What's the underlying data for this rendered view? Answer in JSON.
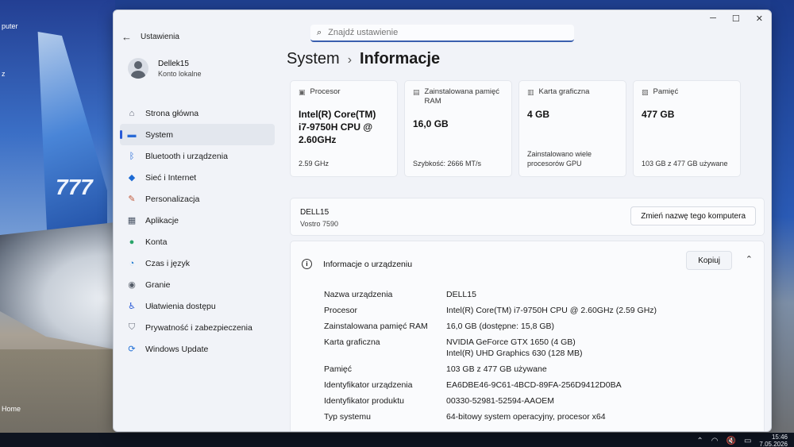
{
  "desktop": {
    "icon_label_top": "puter",
    "icon_label_mid": "z",
    "icon_label_bottom": "Home",
    "plane_text": "777"
  },
  "taskbar": {
    "time": "15:46",
    "date": "7.05.2026"
  },
  "window": {
    "app_title": "Ustawienia",
    "search_placeholder": "Znajdź ustawienie"
  },
  "sidebar": {
    "user_name": "Dellek15",
    "user_type": "Konto lokalne",
    "items": [
      {
        "label": "Strona główna",
        "icon": "home-icon"
      },
      {
        "label": "System",
        "icon": "monitor-icon",
        "active": true
      },
      {
        "label": "Bluetooth i urządzenia",
        "icon": "bluetooth-icon"
      },
      {
        "label": "Sieć i Internet",
        "icon": "wifi-icon"
      },
      {
        "label": "Personalizacja",
        "icon": "brush-icon"
      },
      {
        "label": "Aplikacje",
        "icon": "apps-icon"
      },
      {
        "label": "Konta",
        "icon": "person-icon"
      },
      {
        "label": "Czas i język",
        "icon": "globe-clock-icon"
      },
      {
        "label": "Granie",
        "icon": "gamepad-icon"
      },
      {
        "label": "Ułatwienia dostępu",
        "icon": "accessibility-icon"
      },
      {
        "label": "Prywatność i zabezpieczenia",
        "icon": "shield-icon"
      },
      {
        "label": "Windows Update",
        "icon": "update-icon"
      }
    ]
  },
  "main": {
    "breadcrumb_parent": "System",
    "breadcrumb_sep": "›",
    "breadcrumb_current": "Informacje",
    "cards": [
      {
        "label": "Procesor",
        "value": "Intel(R) Core(TM) i7-9750H CPU @ 2.60GHz",
        "sub": "2.59 GHz",
        "icon": "cpu-icon"
      },
      {
        "label": "Zainstalowana pamięć RAM",
        "value": "16,0 GB",
        "sub": "Szybkość: 2666 MT/s",
        "icon": "ram-icon"
      },
      {
        "label": "Karta graficzna",
        "value": "4 GB",
        "sub": "Zainstalowano wiele procesorów GPU",
        "icon": "gpu-icon"
      },
      {
        "label": "Pamięć",
        "value": "477 GB",
        "sub": "103 GB z 477 GB używane",
        "icon": "storage-icon"
      }
    ],
    "computer": {
      "name": "DELL15",
      "model": "Vostro 7590",
      "rename_label": "Zmień nazwę tego komputera"
    },
    "device_info": {
      "title": "Informacje o urządzeniu",
      "copy_label": "Kopiuj",
      "rows": [
        {
          "key": "Nazwa urządzenia",
          "values": [
            "DELL15"
          ]
        },
        {
          "key": "Procesor",
          "values": [
            "Intel(R) Core(TM) i7-9750H CPU @ 2.60GHz (2.59 GHz)"
          ]
        },
        {
          "key": "Zainstalowana pamięć RAM",
          "values": [
            "16,0 GB (dostępne: 15,8 GB)"
          ]
        },
        {
          "key": "Karta graficzna",
          "values": [
            "NVIDIA GeForce GTX 1650 (4 GB)",
            "Intel(R) UHD Graphics 630 (128 MB)"
          ]
        },
        {
          "key": "Pamięć",
          "values": [
            "103 GB z 477 GB używane"
          ]
        },
        {
          "key": "Identyfikator urządzenia",
          "values": [
            "EA6DBE46-9C61-4BCD-89FA-256D9412D0BA"
          ]
        },
        {
          "key": "Identyfikator produktu",
          "values": [
            "00330-52981-52594-AAOEM"
          ]
        },
        {
          "key": "Typ systemu",
          "values": [
            "64-bitowy system operacyjny, procesor x64"
          ]
        }
      ]
    }
  }
}
